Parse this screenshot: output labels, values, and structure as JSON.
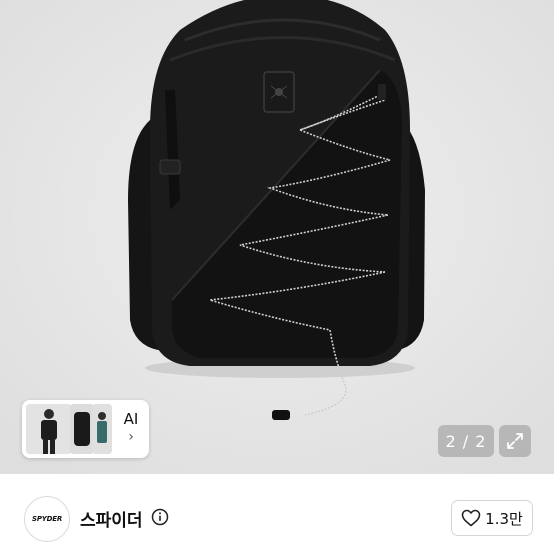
{
  "gallery": {
    "counter": "2 / 2",
    "ai_label": "AI",
    "ai_chevron": "›"
  },
  "brand": {
    "logo_text": "SPYDER",
    "name": "스파이더"
  },
  "like": {
    "count": "1.3만"
  }
}
